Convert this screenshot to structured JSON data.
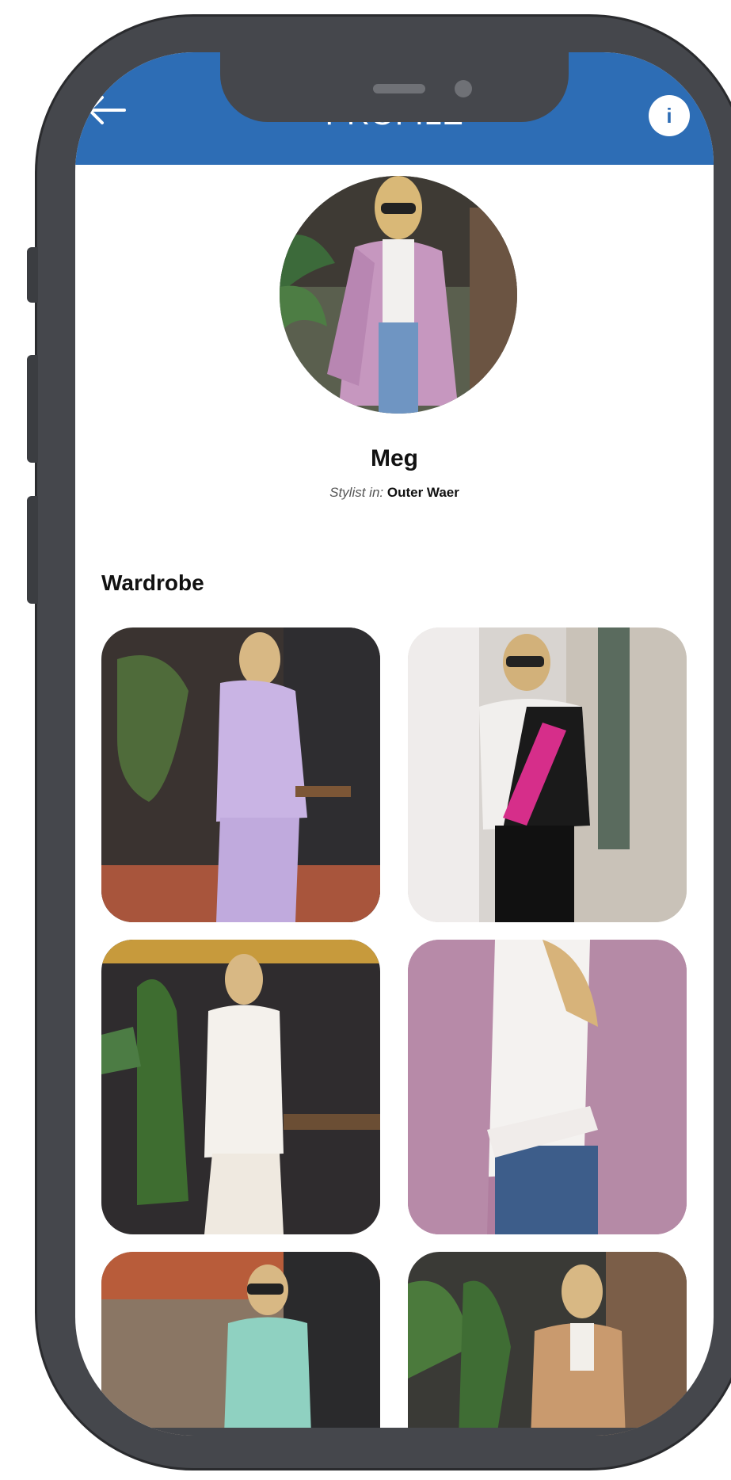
{
  "header": {
    "title": "PROFILE",
    "back_icon": "arrow-left-icon",
    "info_label": "i"
  },
  "profile": {
    "name": "Meg",
    "stylist_prefix": "Stylist in:",
    "stylist_category": "Outer Waer"
  },
  "wardrobe": {
    "title": "Wardrobe",
    "items": [
      {
        "desc": "lilac knit set"
      },
      {
        "desc": "white black pink sweater"
      },
      {
        "desc": "white knit set"
      },
      {
        "desc": "pink teddy coat"
      },
      {
        "desc": "mint green sweater"
      },
      {
        "desc": "camel coat"
      }
    ]
  },
  "colors": {
    "header": "#2d6db5",
    "phone_frame": "#45474c"
  }
}
